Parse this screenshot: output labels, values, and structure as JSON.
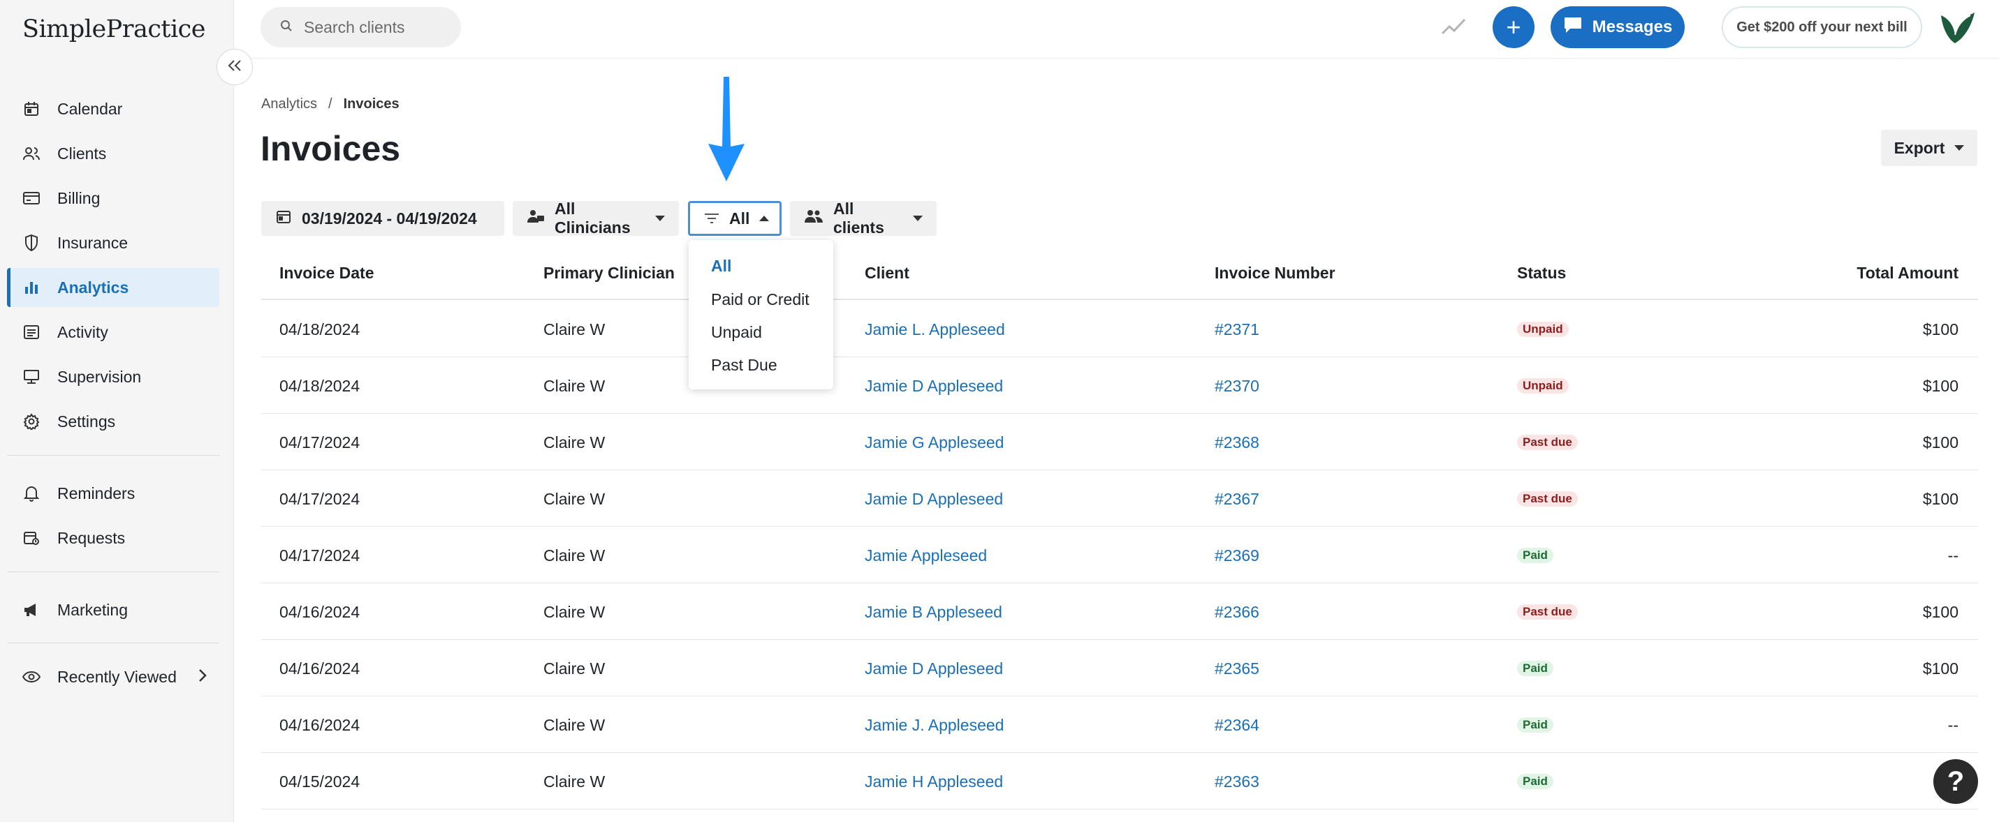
{
  "sidebar": {
    "logo": "SimplePractice",
    "nav": [
      {
        "label": "Calendar",
        "icon": "calendar-icon"
      },
      {
        "label": "Clients",
        "icon": "clients-icon"
      },
      {
        "label": "Billing",
        "icon": "billing-icon"
      },
      {
        "label": "Insurance",
        "icon": "shield-icon"
      },
      {
        "label": "Analytics",
        "icon": "bar-chart-icon",
        "active": true
      },
      {
        "label": "Activity",
        "icon": "activity-icon"
      },
      {
        "label": "Supervision",
        "icon": "supervision-icon"
      },
      {
        "label": "Settings",
        "icon": "gear-icon"
      }
    ],
    "nav2": [
      {
        "label": "Reminders",
        "icon": "bell-icon"
      },
      {
        "label": "Requests",
        "icon": "requests-icon"
      }
    ],
    "marketing": {
      "label": "Marketing",
      "icon": "megaphone-icon"
    },
    "recently_viewed": {
      "label": "Recently Viewed",
      "icon": "eye-icon"
    }
  },
  "topbar": {
    "search_placeholder": "Search clients",
    "messages_label": "Messages",
    "promo_label": "Get $200 off your next bill"
  },
  "breadcrumb": {
    "parent": "Analytics",
    "separator": "/",
    "current": "Invoices"
  },
  "page_title": "Invoices",
  "export_label": "Export",
  "filters": {
    "date_range": "03/19/2024 - 04/19/2024",
    "clinicians": "All Clinicians",
    "status": "All",
    "clients": "All clients"
  },
  "status_dropdown": {
    "options": [
      "All",
      "Paid or Credit",
      "Unpaid",
      "Past Due"
    ],
    "selected": "All"
  },
  "table": {
    "headers": [
      "Invoice Date",
      "Primary Clinician",
      "Client",
      "Invoice Number",
      "Status",
      "Total Amount"
    ],
    "rows": [
      {
        "date": "04/18/2024",
        "clinician": "Claire W",
        "client": "Jamie L. Appleseed",
        "number": "#2371",
        "status": "Unpaid",
        "status_type": "unpaid",
        "amount": "$100"
      },
      {
        "date": "04/18/2024",
        "clinician": "Claire W",
        "client": "Jamie D Appleseed",
        "number": "#2370",
        "status": "Unpaid",
        "status_type": "unpaid",
        "amount": "$100"
      },
      {
        "date": "04/17/2024",
        "clinician": "Claire W",
        "client": "Jamie G Appleseed",
        "number": "#2368",
        "status": "Past due",
        "status_type": "pastdue",
        "amount": "$100"
      },
      {
        "date": "04/17/2024",
        "clinician": "Claire W",
        "client": "Jamie D Appleseed",
        "number": "#2367",
        "status": "Past due",
        "status_type": "pastdue",
        "amount": "$100"
      },
      {
        "date": "04/17/2024",
        "clinician": "Claire W",
        "client": "Jamie Appleseed",
        "number": "#2369",
        "status": "Paid",
        "status_type": "paid",
        "amount": "--"
      },
      {
        "date": "04/16/2024",
        "clinician": "Claire W",
        "client": "Jamie B Appleseed",
        "number": "#2366",
        "status": "Past due",
        "status_type": "pastdue",
        "amount": "$100"
      },
      {
        "date": "04/16/2024",
        "clinician": "Claire W",
        "client": "Jamie D Appleseed",
        "number": "#2365",
        "status": "Paid",
        "status_type": "paid",
        "amount": "$100"
      },
      {
        "date": "04/16/2024",
        "clinician": "Claire W",
        "client": "Jamie J. Appleseed",
        "number": "#2364",
        "status": "Paid",
        "status_type": "paid",
        "amount": "--"
      },
      {
        "date": "04/15/2024",
        "clinician": "Claire W",
        "client": "Jamie H Appleseed",
        "number": "#2363",
        "status": "Paid",
        "status_type": "paid",
        "amount": ""
      }
    ]
  },
  "help_label": "?",
  "colors": {
    "accent": "#1a6fc4",
    "link": "#1a6fb5",
    "arrow": "#1e90ff"
  }
}
